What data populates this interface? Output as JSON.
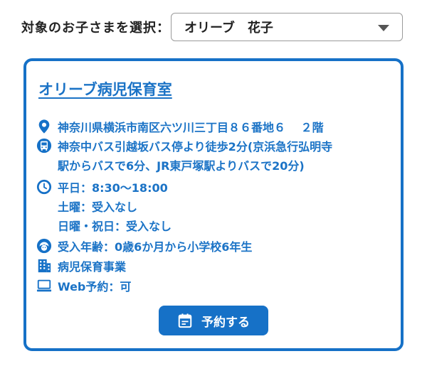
{
  "selector": {
    "label": "対象のお子さまを選択：",
    "selected_value": "オリーブ　花子"
  },
  "facility": {
    "name": "オリーブ病児保育室",
    "address": "神奈川県横浜市南区六ツ川三丁目８６番地６　 ２階",
    "access_line1": "神奈中バス引越坂バス停より徒歩2分(京浜急行弘明寺",
    "access_line2": "駅からバスで6分、JR東戸塚駅よりバスで20分)",
    "hours_weekday": "平日：8:30〜18:00",
    "hours_saturday": "土曜：受入なし",
    "hours_sunday": "日曜・祝日：受入なし",
    "age_range": "受入年齢：0歳6か月から小学校6年生",
    "service_type": "病児保育事業",
    "web_reservation": "Web予約：可"
  },
  "reserve_button": {
    "label": "予約する"
  },
  "icons": {
    "address": "location-pin-icon",
    "access": "bus-icon",
    "hours": "clock-icon",
    "age": "child-face-icon",
    "service": "building-icon",
    "web": "laptop-icon",
    "reserve": "calendar-icon"
  },
  "colors": {
    "accent": "#1671c7",
    "text_link": "#1b73c6"
  }
}
